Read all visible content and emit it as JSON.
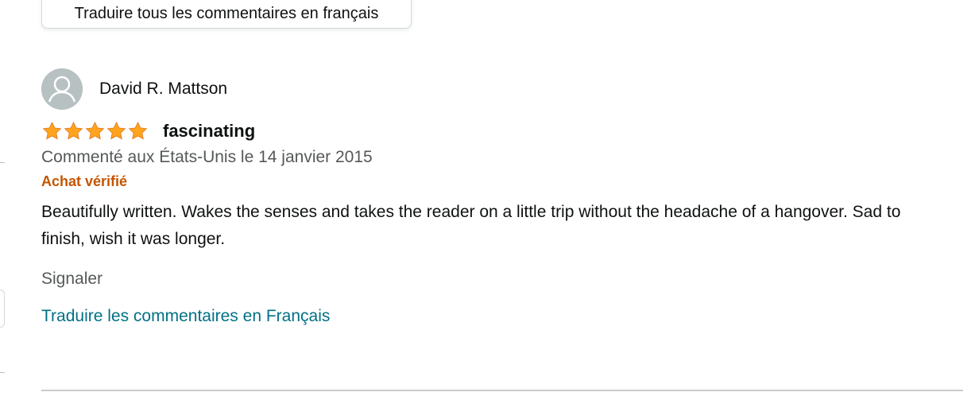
{
  "toolbar": {
    "translate_all_label": "Traduire tous les commentaires en français"
  },
  "review": {
    "reviewer_name": "David R. Mattson",
    "avatar_icon": "user-silhouette-icon",
    "rating": 5,
    "rating_max": 5,
    "star_icon": "star-icon",
    "star_color": "#ffa41c",
    "title": "fascinating",
    "date": "Commenté aux États-Unis le 14 janvier 2015",
    "verified": "Achat vérifié",
    "verified_color": "#c45500",
    "body": "Beautifully written. Wakes the senses and takes the reader on a little trip without the headache of a hangover. Sad to finish, wish it was longer.",
    "report_label": "Signaler",
    "translate_label": "Traduire les commentaires en Français",
    "link_color": "#007185"
  }
}
